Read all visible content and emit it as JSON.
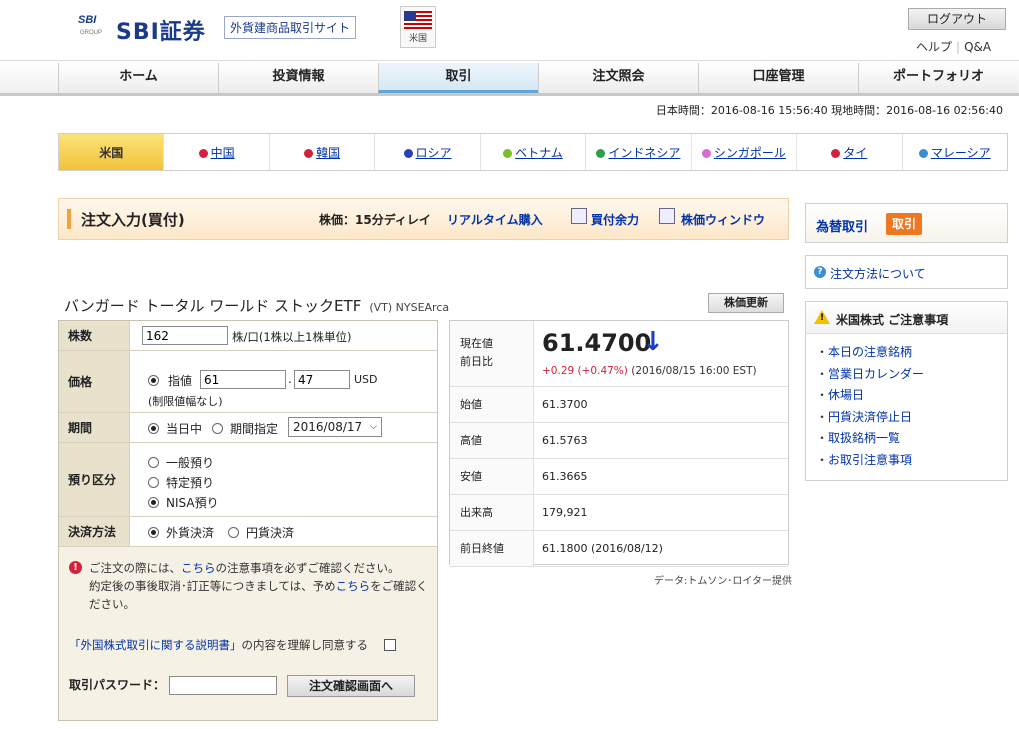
{
  "header": {
    "logo_sbi": "SBI",
    "logo_group": "GROUP",
    "logo_text": "SBI証券",
    "site_badge": "外貨建商品取引サイト",
    "flag_label": "米国",
    "logout": "ログアウト",
    "help": "ヘルプ",
    "qa": "Q&A"
  },
  "nav": {
    "tabs": [
      "ホーム",
      "投資情報",
      "取引",
      "注文照会",
      "口座管理",
      "ポートフォリオ"
    ],
    "active_index": 2
  },
  "datetime": "日本時間：2016-08-16 15:56:40 現地時間：2016-08-16 02:56:40",
  "countries": {
    "items": [
      {
        "label": "米国",
        "color": ""
      },
      {
        "label": "中国",
        "color": "#d4213b"
      },
      {
        "label": "韓国",
        "color": "#d4213b"
      },
      {
        "label": "ロシア",
        "color": "#2b3fb4"
      },
      {
        "label": "ベトナム",
        "color": "#7cbf2a"
      },
      {
        "label": "インドネシア",
        "color": "#2aa04a"
      },
      {
        "label": "シンガポール",
        "color": "#d96ad2"
      },
      {
        "label": "タイ",
        "color": "#d4213b"
      },
      {
        "label": "マレーシア",
        "color": "#3a8fd4"
      }
    ]
  },
  "order_head": {
    "title": "注文入力(買付)",
    "delay": "株価：15分ディレイ",
    "realtime": "リアルタイム購入",
    "buying_power": "買付余力",
    "price_window": "株価ウィンドウ"
  },
  "stock": {
    "name": "バンガード トータル ワールド ストックETF",
    "code": "(VT) NYSEArca",
    "refresh": "株価更新"
  },
  "form": {
    "shares_label": "株数",
    "shares_value": "162",
    "shares_unit": "株/口(1株以上1株単位)",
    "price_label": "価格",
    "limit_label": "指値",
    "price_int": "61",
    "price_dec": "47",
    "price_unit": "USD",
    "price_note": "(制限値幅なし)",
    "period_label": "期間",
    "period_today": "当日中",
    "period_specify": "期間指定",
    "period_date": "2016/08/17",
    "account_label": "預り区分",
    "account_general": "一般預り",
    "account_specific": "特定預り",
    "account_nisa": "NISA預り",
    "settle_label": "決済方法",
    "settle_fx": "外貨決済",
    "settle_jpy": "円貨決済",
    "notice_1": "ご注文の際には、",
    "notice_link1": "こちら",
    "notice_2": "の注意事項を必ずご確認ください。",
    "notice_3": "約定後の事後取消･訂正等につきましては、予め",
    "notice_link2": "こちら",
    "notice_4": "をご確認ください。",
    "agree_link": "「外国株式取引に関する説明書」",
    "agree_text": "の内容を理解し同意する",
    "pwd_label": "取引パスワード：",
    "confirm": "注文確認画面へ"
  },
  "quote": {
    "price_label_1": "現在値",
    "price_label_2": "前日比",
    "price": "61.4700",
    "change": "+0.29",
    "change_pct": "(+0.47%)",
    "change_time": "(2016/08/15 16:00 EST)",
    "rows": [
      {
        "label": "始値",
        "value": "61.3700"
      },
      {
        "label": "高値",
        "value": "61.5763"
      },
      {
        "label": "安値",
        "value": "61.3665"
      },
      {
        "label": "出来高",
        "value": "179,921"
      },
      {
        "label": "前日終値",
        "value": "61.1800 (2016/08/12)"
      }
    ],
    "credit": "データ:トムソン･ロイター提供"
  },
  "sidebar": {
    "fx_link": "為替取引",
    "fx_button": "取引",
    "howto": "注文方法について",
    "cautions_title": "米国株式 ご注意事項",
    "cautions": [
      "本日の注意銘柄",
      "営業日カレンダー",
      "休場日",
      "円貨決済停止日",
      "取扱銘柄一覧",
      "お取引注意事項"
    ]
  }
}
